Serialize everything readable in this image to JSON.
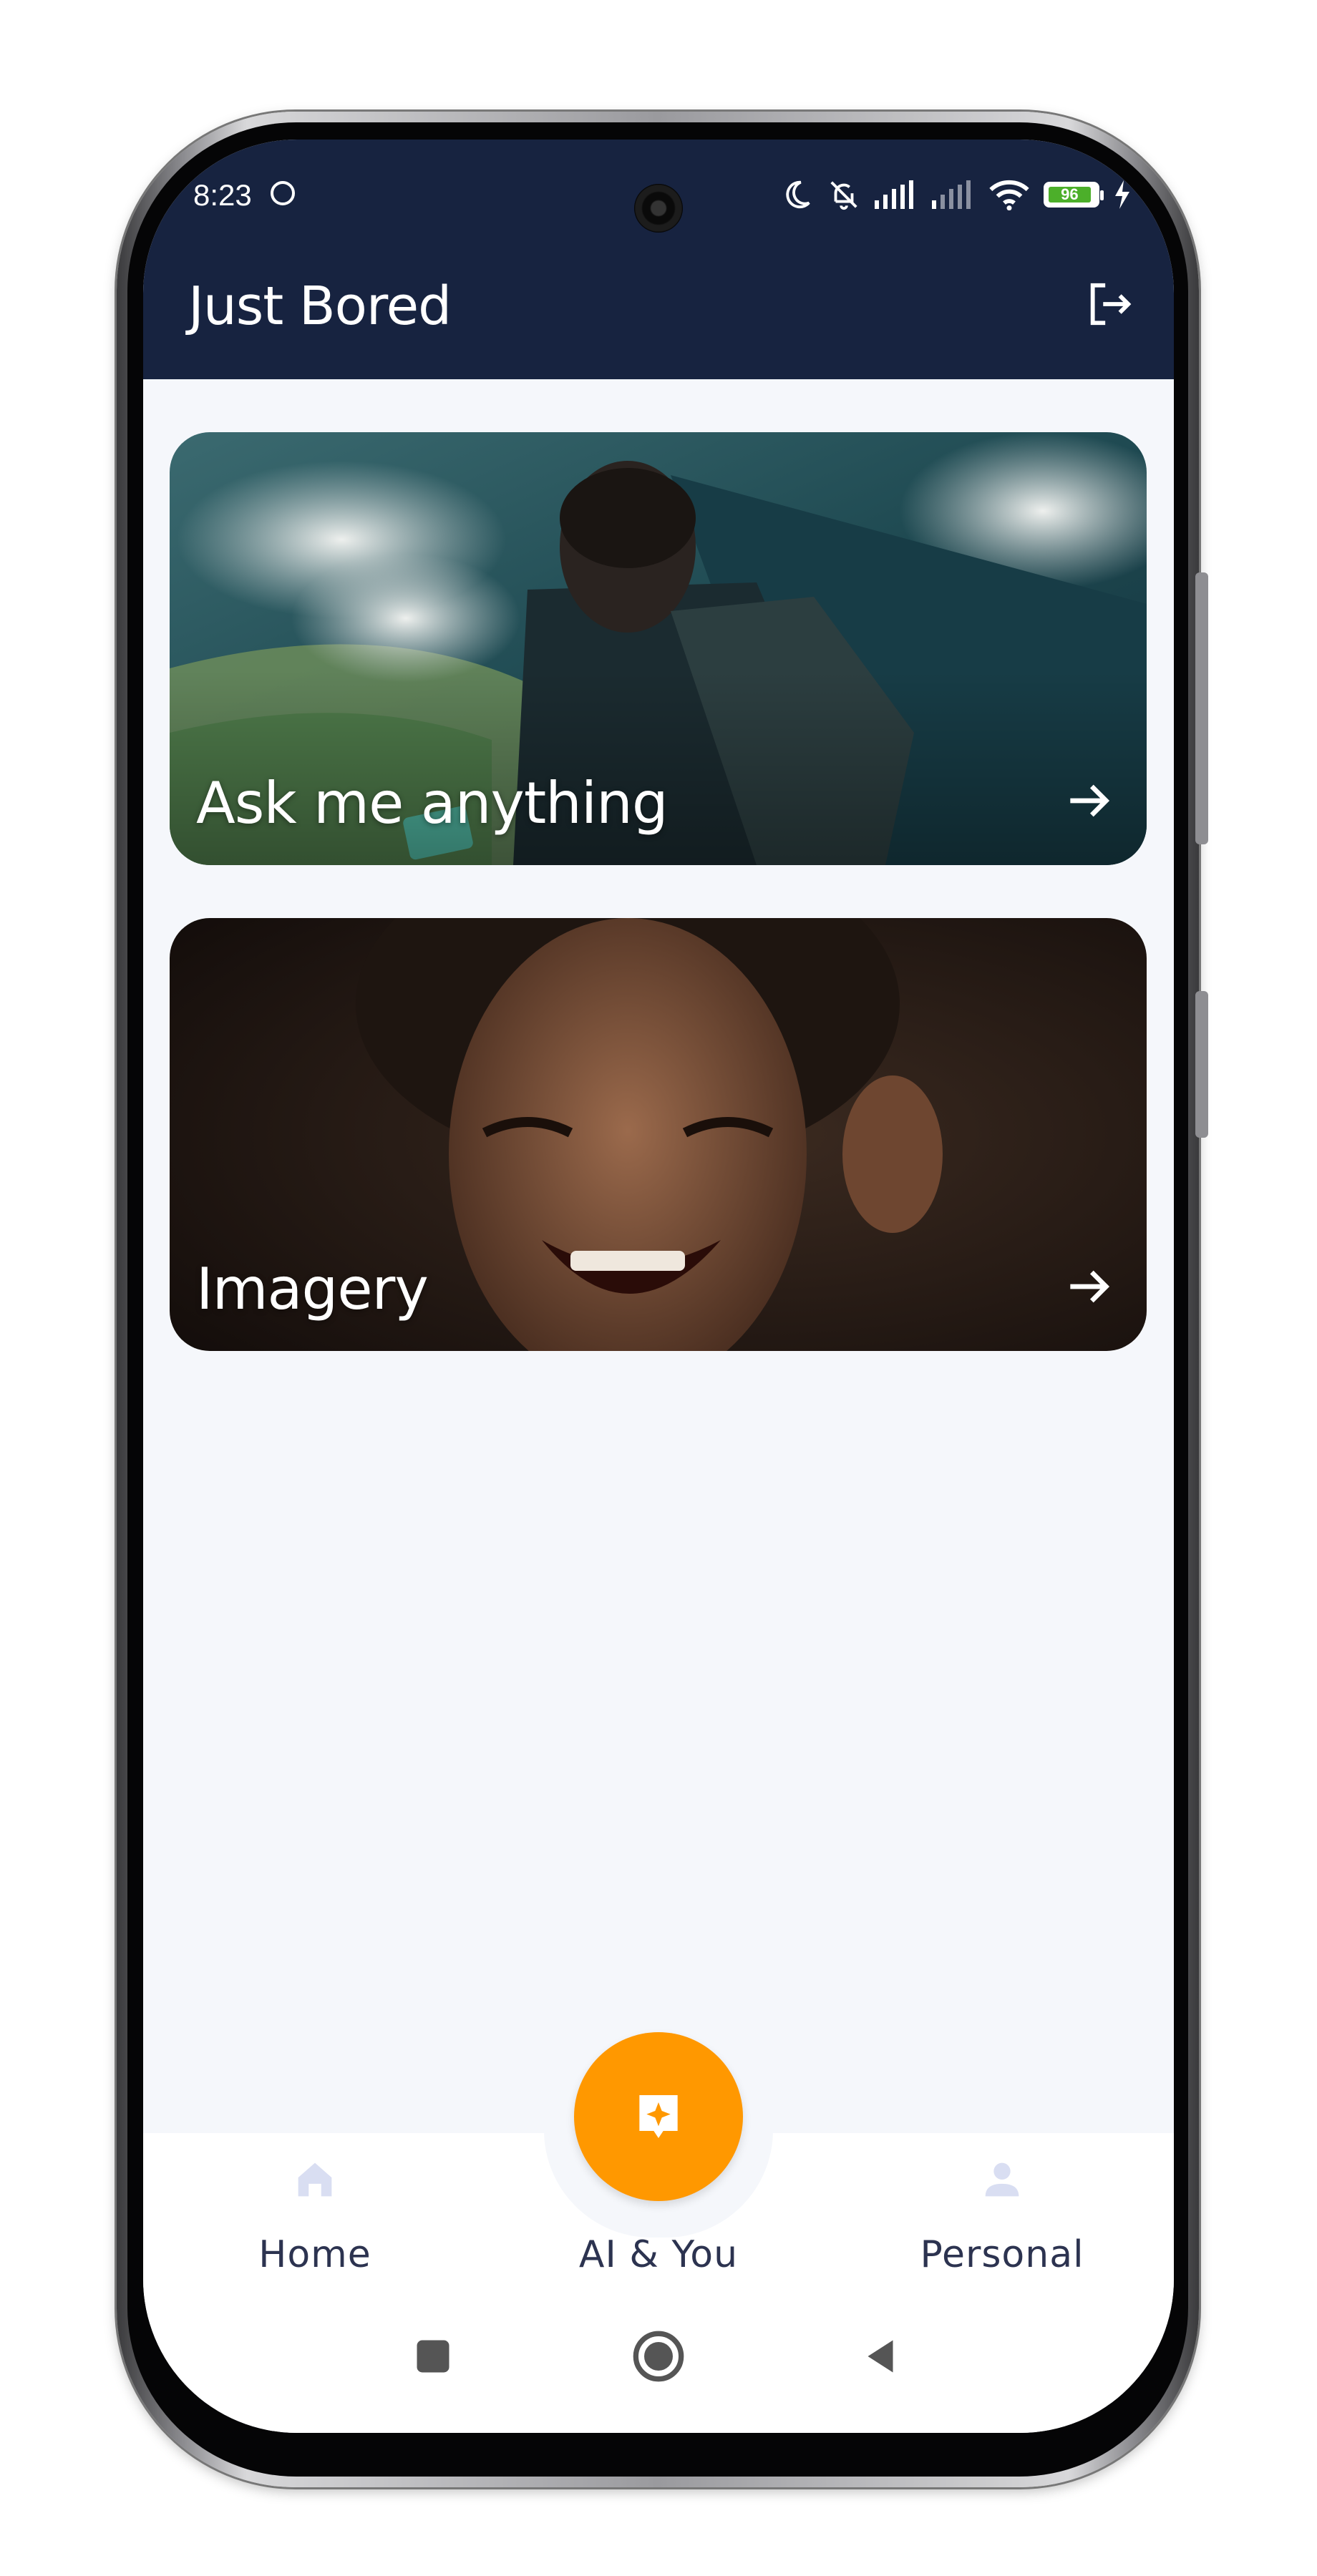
{
  "status_bar": {
    "time": "8:23",
    "battery_level": "96"
  },
  "header": {
    "title": "Just Bored",
    "logout_icon": "logout-icon"
  },
  "cards": [
    {
      "label": "Ask me anything",
      "image": "man-with-backpack-looking-at-phone-on-mountain",
      "icon": "arrow-right-icon"
    },
    {
      "label": "Imagery",
      "image": "laughing-child-portrait",
      "icon": "arrow-right-icon"
    }
  ],
  "bottom_nav": {
    "items": [
      {
        "label": "Home",
        "icon": "home-icon"
      },
      {
        "label": "AI & You",
        "icon": "ai-chat-sparkle-icon"
      },
      {
        "label": "Personal",
        "icon": "person-icon"
      }
    ],
    "accent_color": "#ff9800",
    "inactive_icon_color": "#d9def2"
  },
  "system_nav": [
    "recents-square-icon",
    "home-circle-icon",
    "back-triangle-icon"
  ],
  "colors": {
    "header_bg": "#172340",
    "screen_bg": "#f5f7fb",
    "text_dark": "#2c3350"
  }
}
